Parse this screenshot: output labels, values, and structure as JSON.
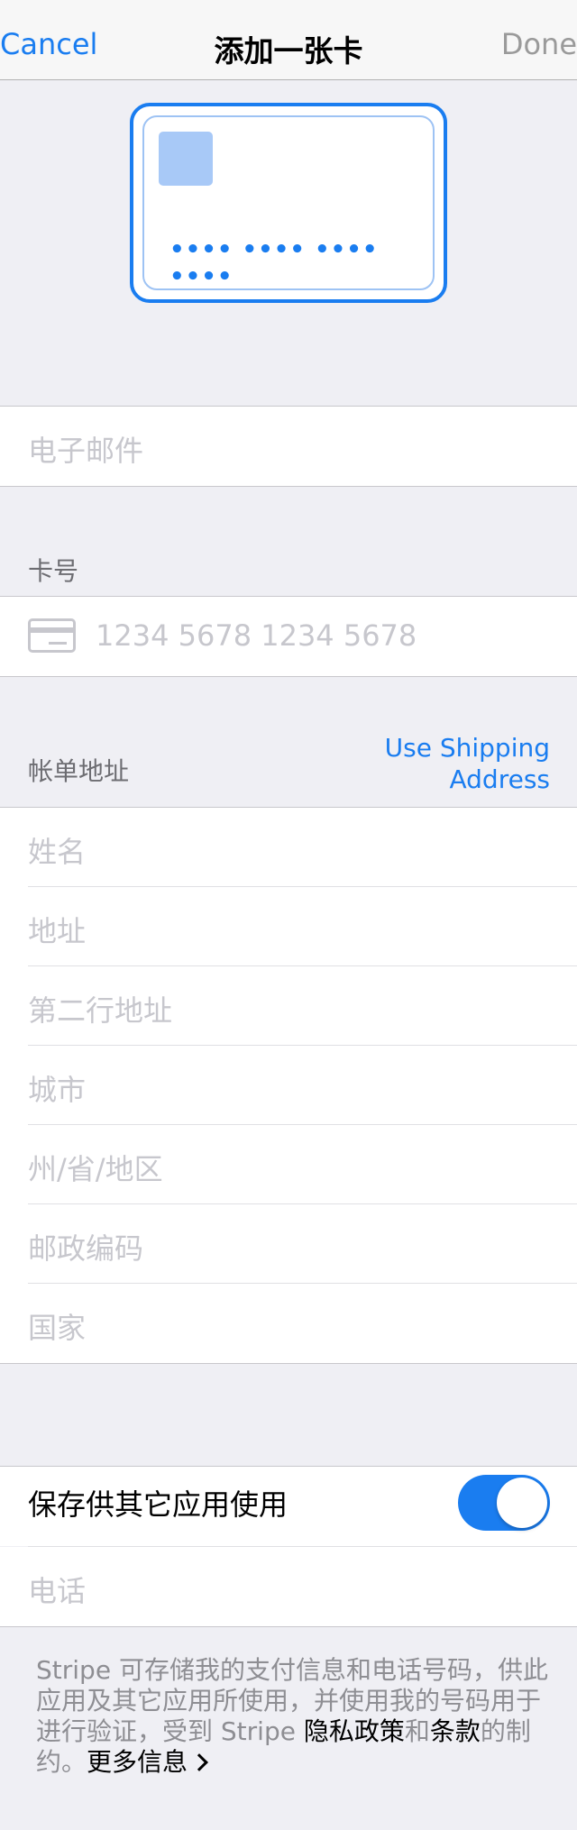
{
  "nav": {
    "cancel_label": "Cancel",
    "title": "添加一张卡",
    "done_label": "Done"
  },
  "card_preview": {
    "number_placeholder": "•••• •••• •••• ••••"
  },
  "email": {
    "placeholder": "电子邮件"
  },
  "card_section": {
    "header": "卡号",
    "number_placeholder": "1234 5678 1234 5678"
  },
  "billing": {
    "header": "帐单地址",
    "use_shipping_line1": "Use Shipping",
    "use_shipping_line2": "Address",
    "fields": {
      "name": "姓名",
      "address": "地址",
      "address2": "第二行地址",
      "city": "城市",
      "state": "州/省/地区",
      "postal": "邮政编码",
      "country": "国家"
    }
  },
  "save": {
    "label": "保存供其它应用使用",
    "toggle_on": true,
    "phone_placeholder": "电话"
  },
  "footer": {
    "text_1": "Stripe 可存储我的支付信息和电话号码，供此应用及其它应用所使用，并使用我的号码用于进行验证，受到 Stripe ",
    "privacy_link": "隐私政策",
    "text_2": "和",
    "terms_link": "条款",
    "text_3": "的制约。",
    "more_info_link": "更多信息"
  },
  "colors": {
    "accent": "#1a7df0",
    "background": "#efeff4",
    "placeholder": "#c7c7cd",
    "section_label": "#6d6d72"
  }
}
